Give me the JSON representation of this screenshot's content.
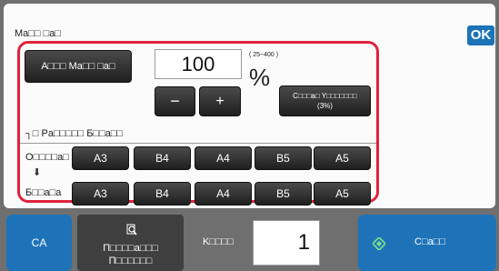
{
  "header": {
    "title": "Ma□□ □a□",
    "ok_label": "OK"
  },
  "auto_button_label": "A□□□ Ma□□ □a□",
  "ratio": {
    "value": "100",
    "range": "( 25~400 )",
    "unit": "%"
  },
  "buttons": {
    "minus": "−",
    "plus": "+",
    "fine_line1": "C□□□a□ Y□□□□□□□",
    "fine_line2": "(3%)"
  },
  "paper_section": {
    "label": "┐□ Pa□□□□□ Б□□a□□",
    "original_label": "O□□□□a□",
    "arrow": "⬇",
    "output_label": "Б□□a□a",
    "original_sizes": [
      "A3",
      "B4",
      "A4",
      "B5",
      "A5"
    ],
    "output_sizes": [
      "A3",
      "B4",
      "A4",
      "B5",
      "A5"
    ]
  },
  "footer": {
    "ca_label": "CA",
    "preview_line1": "П□□□□a□□□",
    "preview_line2": "П□□□□□□",
    "copies_label": "K□□□□",
    "copies_value": "1",
    "start_label": "C□a□□"
  },
  "colors": {
    "accent_blue": "#1e73b8",
    "highlight_red": "#e0233c",
    "button_dark": "#2a2a2a"
  }
}
